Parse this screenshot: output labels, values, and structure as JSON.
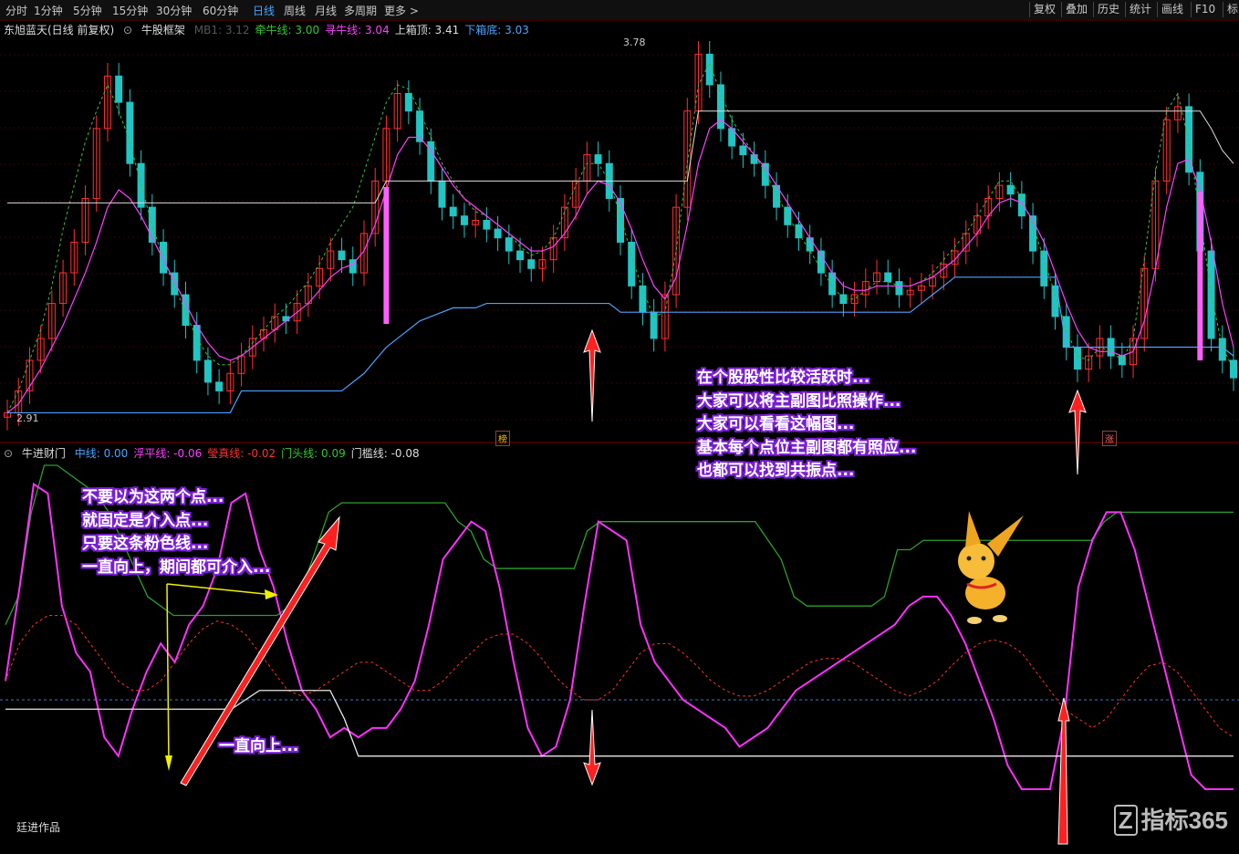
{
  "toolbar": {
    "periods": [
      "分时",
      "1分钟",
      "5分钟",
      "15分钟",
      "30分钟",
      "60分钟",
      "日线",
      "周线",
      "月线",
      "多周期",
      "更多 >"
    ],
    "active": "日线",
    "right_buttons": [
      "复权",
      "叠加",
      "历史",
      "统计",
      "画线",
      "F10",
      "标"
    ]
  },
  "main_legend": {
    "stock": "东旭蓝天(日线 前复权)",
    "indicator": "牛股框架",
    "items": [
      {
        "label": "MB1: 3.12",
        "color": "#555555"
      },
      {
        "label": "牵牛线: 3.00",
        "color": "#34c734"
      },
      {
        "label": "寻牛线: 3.04",
        "color": "#ff40ff"
      },
      {
        "label": "上箱顶: 3.41",
        "color": "#dddddd"
      },
      {
        "label": "下箱底: 3.03",
        "color": "#4aa3ff"
      }
    ]
  },
  "sub_legend": {
    "indicator": "牛进财门",
    "items": [
      {
        "label": "中线: 0.00",
        "color": "#4aa3ff"
      },
      {
        "label": "浮平线: -0.06",
        "color": "#ff40ff"
      },
      {
        "label": "瑩真线: -0.02",
        "color": "#ff3030"
      },
      {
        "label": "门头线: 0.09",
        "color": "#34c734"
      },
      {
        "label": "门槛线: -0.08",
        "color": "#dddddd"
      }
    ]
  },
  "price_labels": {
    "high": "3.78",
    "low": "2.91"
  },
  "marks": {
    "left": "榜",
    "right": "涨"
  },
  "notes": {
    "left": [
      "不要以为这两个点...",
      "就固定是介入点...",
      "只要这条粉色线...",
      "一直向上，期间都可介入..."
    ],
    "up": "一直向上...",
    "right": [
      "在个股股性比较活跃时...",
      "大家可以将主副图比照操作...",
      "大家可以看看这幅图...",
      "基本每个点位主副图都有照应...",
      "也都可以找到共振点..."
    ]
  },
  "author": "廷进作品",
  "watermark": "指标365",
  "colors": {
    "up": "#ff3030",
    "down": "#22c4c4",
    "green": "#2aa02a",
    "pink": "#ff30ff",
    "blue": "#4aa3ff",
    "white": "#e8e8e8",
    "yellow": "#f0f000"
  },
  "chart_data": {
    "type": "candlestick",
    "main": {
      "y_range": [
        2.91,
        3.78
      ],
      "close": [
        2.93,
        2.98,
        3.05,
        3.1,
        3.18,
        3.25,
        3.32,
        3.42,
        3.58,
        3.7,
        3.64,
        3.5,
        3.4,
        3.32,
        3.25,
        3.2,
        3.13,
        3.05,
        3.0,
        2.98,
        3.02,
        3.06,
        3.1,
        3.12,
        3.15,
        3.14,
        3.18,
        3.22,
        3.26,
        3.3,
        3.28,
        3.25,
        3.34,
        3.46,
        3.58,
        3.66,
        3.62,
        3.55,
        3.46,
        3.4,
        3.38,
        3.36,
        3.37,
        3.35,
        3.33,
        3.3,
        3.28,
        3.26,
        3.28,
        3.33,
        3.4,
        3.46,
        3.52,
        3.5,
        3.42,
        3.32,
        3.22,
        3.16,
        3.1,
        3.2,
        3.4,
        3.62,
        3.75,
        3.68,
        3.58,
        3.54,
        3.52,
        3.5,
        3.45,
        3.4,
        3.36,
        3.33,
        3.3,
        3.25,
        3.2,
        3.18,
        3.2,
        3.23,
        3.25,
        3.23,
        3.2,
        3.21,
        3.22,
        3.24,
        3.27,
        3.3,
        3.34,
        3.38,
        3.42,
        3.45,
        3.43,
        3.38,
        3.3,
        3.22,
        3.15,
        3.08,
        3.03,
        3.06,
        3.1,
        3.06,
        3.04,
        3.1,
        3.26,
        3.46,
        3.6,
        3.63,
        3.48,
        3.3,
        3.1,
        3.05,
        3.01
      ],
      "series": [
        {
          "name": "牵牛线",
          "color": "#34c734",
          "values": [
            2.93,
            2.98,
            3.05,
            3.12,
            3.22,
            3.35,
            3.45,
            3.55,
            3.62,
            3.68,
            3.62,
            3.55,
            3.45,
            3.36,
            3.28,
            3.22,
            3.16,
            3.1,
            3.06,
            3.04,
            3.04,
            3.06,
            3.09,
            3.12,
            3.15,
            3.17,
            3.2,
            3.23,
            3.27,
            3.32,
            3.36,
            3.4,
            3.48,
            3.56,
            3.64,
            3.68,
            3.67,
            3.62,
            3.56,
            3.5,
            3.46,
            3.42,
            3.39,
            3.38,
            3.36,
            3.34,
            3.31,
            3.29,
            3.3,
            3.33,
            3.39,
            3.45,
            3.5,
            3.5,
            3.46,
            3.38,
            3.29,
            3.21,
            3.15,
            3.16,
            3.3,
            3.5,
            3.68,
            3.73,
            3.66,
            3.6,
            3.56,
            3.52,
            3.48,
            3.43,
            3.38,
            3.34,
            3.3,
            3.26,
            3.22,
            3.19,
            3.19,
            3.21,
            3.23,
            3.23,
            3.22,
            3.22,
            3.23,
            3.25,
            3.28,
            3.31,
            3.34,
            3.38,
            3.42,
            3.46,
            3.46,
            3.42,
            3.36,
            3.28,
            3.2,
            3.12,
            3.06,
            3.05,
            3.08,
            3.07,
            3.05,
            3.1,
            3.28,
            3.48,
            3.62,
            3.66,
            3.55,
            3.38,
            3.2,
            3.08,
            3.03
          ]
        },
        {
          "name": "寻牛线",
          "color": "#ff40ff",
          "values": [
            2.93,
            2.95,
            2.99,
            3.03,
            3.08,
            3.13,
            3.19,
            3.25,
            3.32,
            3.4,
            3.44,
            3.42,
            3.38,
            3.33,
            3.28,
            3.23,
            3.18,
            3.13,
            3.09,
            3.06,
            3.05,
            3.06,
            3.08,
            3.1,
            3.12,
            3.14,
            3.16,
            3.18,
            3.21,
            3.24,
            3.26,
            3.27,
            3.3,
            3.36,
            3.44,
            3.52,
            3.56,
            3.56,
            3.53,
            3.49,
            3.45,
            3.42,
            3.4,
            3.38,
            3.36,
            3.34,
            3.32,
            3.3,
            3.3,
            3.31,
            3.34,
            3.38,
            3.43,
            3.46,
            3.45,
            3.41,
            3.35,
            3.28,
            3.22,
            3.19,
            3.24,
            3.36,
            3.5,
            3.58,
            3.6,
            3.58,
            3.55,
            3.52,
            3.49,
            3.45,
            3.41,
            3.37,
            3.33,
            3.29,
            3.25,
            3.22,
            3.21,
            3.21,
            3.22,
            3.22,
            3.22,
            3.22,
            3.23,
            3.24,
            3.26,
            3.28,
            3.31,
            3.34,
            3.38,
            3.41,
            3.42,
            3.41,
            3.37,
            3.32,
            3.25,
            3.18,
            3.12,
            3.08,
            3.07,
            3.07,
            3.06,
            3.07,
            3.14,
            3.26,
            3.4,
            3.5,
            3.51,
            3.44,
            3.32,
            3.18,
            3.08
          ]
        },
        {
          "name": "上箱顶",
          "color": "#dddddd",
          "values": [
            3.41,
            3.41,
            3.41,
            3.41,
            3.41,
            3.41,
            3.41,
            3.41,
            3.41,
            3.41,
            3.41,
            3.41,
            3.41,
            3.41,
            3.41,
            3.41,
            3.41,
            3.41,
            3.41,
            3.41,
            3.41,
            3.41,
            3.41,
            3.41,
            3.41,
            3.41,
            3.41,
            3.41,
            3.41,
            3.41,
            3.41,
            3.41,
            3.41,
            3.41,
            3.46,
            3.46,
            3.46,
            3.46,
            3.46,
            3.46,
            3.46,
            3.46,
            3.46,
            3.46,
            3.46,
            3.46,
            3.46,
            3.46,
            3.46,
            3.46,
            3.46,
            3.46,
            3.46,
            3.46,
            3.46,
            3.46,
            3.46,
            3.46,
            3.46,
            3.46,
            3.46,
            3.46,
            3.62,
            3.62,
            3.62,
            3.62,
            3.62,
            3.62,
            3.62,
            3.62,
            3.62,
            3.62,
            3.62,
            3.62,
            3.62,
            3.62,
            3.62,
            3.62,
            3.62,
            3.62,
            3.62,
            3.62,
            3.62,
            3.62,
            3.62,
            3.62,
            3.62,
            3.62,
            3.62,
            3.62,
            3.62,
            3.62,
            3.62,
            3.62,
            3.62,
            3.62,
            3.62,
            3.62,
            3.62,
            3.62,
            3.62,
            3.62,
            3.62,
            3.62,
            3.62,
            3.62,
            3.62,
            3.62,
            3.58,
            3.53,
            3.5
          ]
        },
        {
          "name": "下箱底",
          "color": "#4aa3ff",
          "values": [
            2.93,
            2.93,
            2.93,
            2.93,
            2.93,
            2.93,
            2.93,
            2.93,
            2.93,
            2.93,
            2.93,
            2.93,
            2.93,
            2.93,
            2.93,
            2.93,
            2.93,
            2.93,
            2.93,
            2.93,
            2.93,
            2.98,
            2.98,
            2.98,
            2.98,
            2.98,
            2.98,
            2.98,
            2.98,
            2.98,
            2.98,
            3.0,
            3.02,
            3.05,
            3.08,
            3.1,
            3.12,
            3.14,
            3.15,
            3.16,
            3.17,
            3.17,
            3.17,
            3.18,
            3.18,
            3.18,
            3.18,
            3.18,
            3.18,
            3.18,
            3.18,
            3.18,
            3.18,
            3.18,
            3.18,
            3.16,
            3.16,
            3.16,
            3.16,
            3.16,
            3.16,
            3.16,
            3.16,
            3.16,
            3.16,
            3.16,
            3.16,
            3.16,
            3.16,
            3.16,
            3.16,
            3.16,
            3.16,
            3.16,
            3.16,
            3.16,
            3.16,
            3.16,
            3.16,
            3.16,
            3.16,
            3.16,
            3.18,
            3.2,
            3.22,
            3.24,
            3.24,
            3.24,
            3.24,
            3.24,
            3.24,
            3.24,
            3.24,
            3.24,
            3.24,
            3.08,
            3.08,
            3.08,
            3.08,
            3.08,
            3.08,
            3.08,
            3.08,
            3.08,
            3.08,
            3.08,
            3.08,
            3.08,
            3.08,
            3.08,
            3.06
          ]
        }
      ]
    },
    "sub": {
      "series": [
        {
          "name": "门头线",
          "color": "#2aa02a",
          "values": [
            0.4,
            0.55,
            1.0,
            1.25,
            1.25,
            1.2,
            1.15,
            1.1,
            1.0,
            0.85,
            0.7,
            0.55,
            0.5,
            0.45,
            0.45,
            0.45,
            0.45,
            0.45,
            0.45,
            0.45,
            0.45,
            0.45,
            0.5,
            0.6,
            0.8,
            1.0,
            1.05,
            1.05,
            1.05,
            1.05,
            1.05,
            1.05,
            1.05,
            1.05,
            1.05,
            0.95,
            0.9,
            0.75,
            0.7,
            0.7,
            0.7,
            0.7,
            0.7,
            0.7,
            0.7,
            0.9,
            0.95,
            0.95,
            0.95,
            0.95,
            0.95,
            0.95,
            0.95,
            0.95,
            0.95,
            0.95,
            0.95,
            0.95,
            0.95,
            0.85,
            0.75,
            0.55,
            0.5,
            0.5,
            0.5,
            0.5,
            0.5,
            0.5,
            0.55,
            0.8,
            0.8,
            0.85,
            0.85,
            0.85,
            0.85,
            0.85,
            0.85,
            0.85,
            0.85,
            0.85,
            0.85,
            0.85,
            0.85,
            0.85,
            0.85,
            0.95,
            1.0,
            1.0,
            1.0,
            1.0,
            1.0,
            1.0,
            1.0,
            1.0,
            1.0,
            1.0
          ]
        },
        {
          "name": "浮平线",
          "color": "#ff30ff",
          "values": [
            0.1,
            0.6,
            1.15,
            1.1,
            0.5,
            0.25,
            0.15,
            -0.2,
            -0.3,
            -0.05,
            0.15,
            0.3,
            0.2,
            0.4,
            0.5,
            0.7,
            1.05,
            1.1,
            0.8,
            0.6,
            0.3,
            0.05,
            -0.05,
            -0.2,
            -0.15,
            -0.2,
            -0.15,
            -0.15,
            -0.05,
            0.1,
            0.4,
            0.75,
            0.85,
            0.95,
            0.9,
            0.6,
            0.2,
            -0.15,
            -0.3,
            -0.25,
            0.0,
            0.5,
            0.95,
            0.9,
            0.85,
            0.4,
            0.2,
            0.1,
            0.0,
            -0.05,
            -0.1,
            -0.15,
            -0.25,
            -0.2,
            -0.15,
            -0.05,
            0.05,
            0.1,
            0.15,
            0.2,
            0.25,
            0.3,
            0.35,
            0.4,
            0.5,
            0.55,
            0.55,
            0.45,
            0.3,
            0.1,
            -0.1,
            -0.35,
            -0.5,
            -0.55,
            -0.6,
            -0.1,
            0.6,
            0.85,
            1.0,
            1.0,
            0.8,
            0.5,
            0.2,
            -0.1,
            -0.4,
            -0.6,
            -0.7,
            -0.7
          ]
        },
        {
          "name": "瑩真线",
          "color": "#ff3030",
          "values": [
            0.1,
            0.3,
            0.4,
            0.45,
            0.45,
            0.4,
            0.3,
            0.2,
            0.1,
            0.05,
            0.05,
            0.1,
            0.2,
            0.3,
            0.38,
            0.42,
            0.4,
            0.35,
            0.25,
            0.15,
            0.05,
            0.02,
            0.05,
            0.1,
            0.15,
            0.2,
            0.2,
            0.15,
            0.1,
            0.05,
            0.05,
            0.1,
            0.18,
            0.25,
            0.32,
            0.35,
            0.35,
            0.3,
            0.22,
            0.12,
            0.05,
            0.0,
            0.0,
            0.05,
            0.15,
            0.25,
            0.3,
            0.3,
            0.25,
            0.18,
            0.1,
            0.05,
            0.02,
            0.02,
            0.05,
            0.1,
            0.15,
            0.2,
            0.22,
            0.22,
            0.2,
            0.15,
            0.1,
            0.05,
            0.02,
            0.05,
            0.1,
            0.18,
            0.25,
            0.3,
            0.32,
            0.3,
            0.25,
            0.15,
            0.05,
            -0.05,
            -0.1,
            -0.15,
            -0.1,
            0.0,
            0.1,
            0.18,
            0.2,
            0.15,
            0.05,
            -0.05,
            -0.15,
            -0.2
          ]
        },
        {
          "name": "门槛线",
          "color": "#e8e8e8",
          "values": [
            -0.05,
            -0.05,
            -0.05,
            -0.05,
            -0.05,
            -0.05,
            -0.05,
            -0.05,
            -0.05,
            -0.05,
            -0.05,
            -0.05,
            -0.05,
            -0.05,
            -0.05,
            -0.05,
            -0.05,
            0.0,
            0.05,
            0.05,
            0.05,
            0.05,
            0.05,
            0.05,
            -0.1,
            -0.3,
            -0.3,
            -0.3,
            -0.3,
            -0.3,
            -0.3,
            -0.3,
            -0.3,
            -0.3,
            -0.3,
            -0.3,
            -0.3,
            -0.3,
            -0.3,
            -0.3,
            -0.3,
            -0.3,
            -0.3,
            -0.3,
            -0.3,
            -0.3,
            -0.3,
            -0.3,
            -0.3,
            -0.3,
            -0.3,
            -0.3,
            -0.3,
            -0.3,
            -0.3,
            -0.3,
            -0.3,
            -0.3,
            -0.3,
            -0.3,
            -0.3,
            -0.3,
            -0.3,
            -0.3,
            -0.3,
            -0.3,
            -0.3,
            -0.3,
            -0.3,
            -0.3,
            -0.3,
            -0.3,
            -0.3,
            -0.3,
            -0.3,
            -0.3,
            -0.3,
            -0.3,
            -0.3,
            -0.3,
            -0.3,
            -0.3,
            -0.3,
            -0.3,
            -0.3,
            -0.3,
            -0.3,
            -0.3
          ]
        }
      ]
    }
  }
}
